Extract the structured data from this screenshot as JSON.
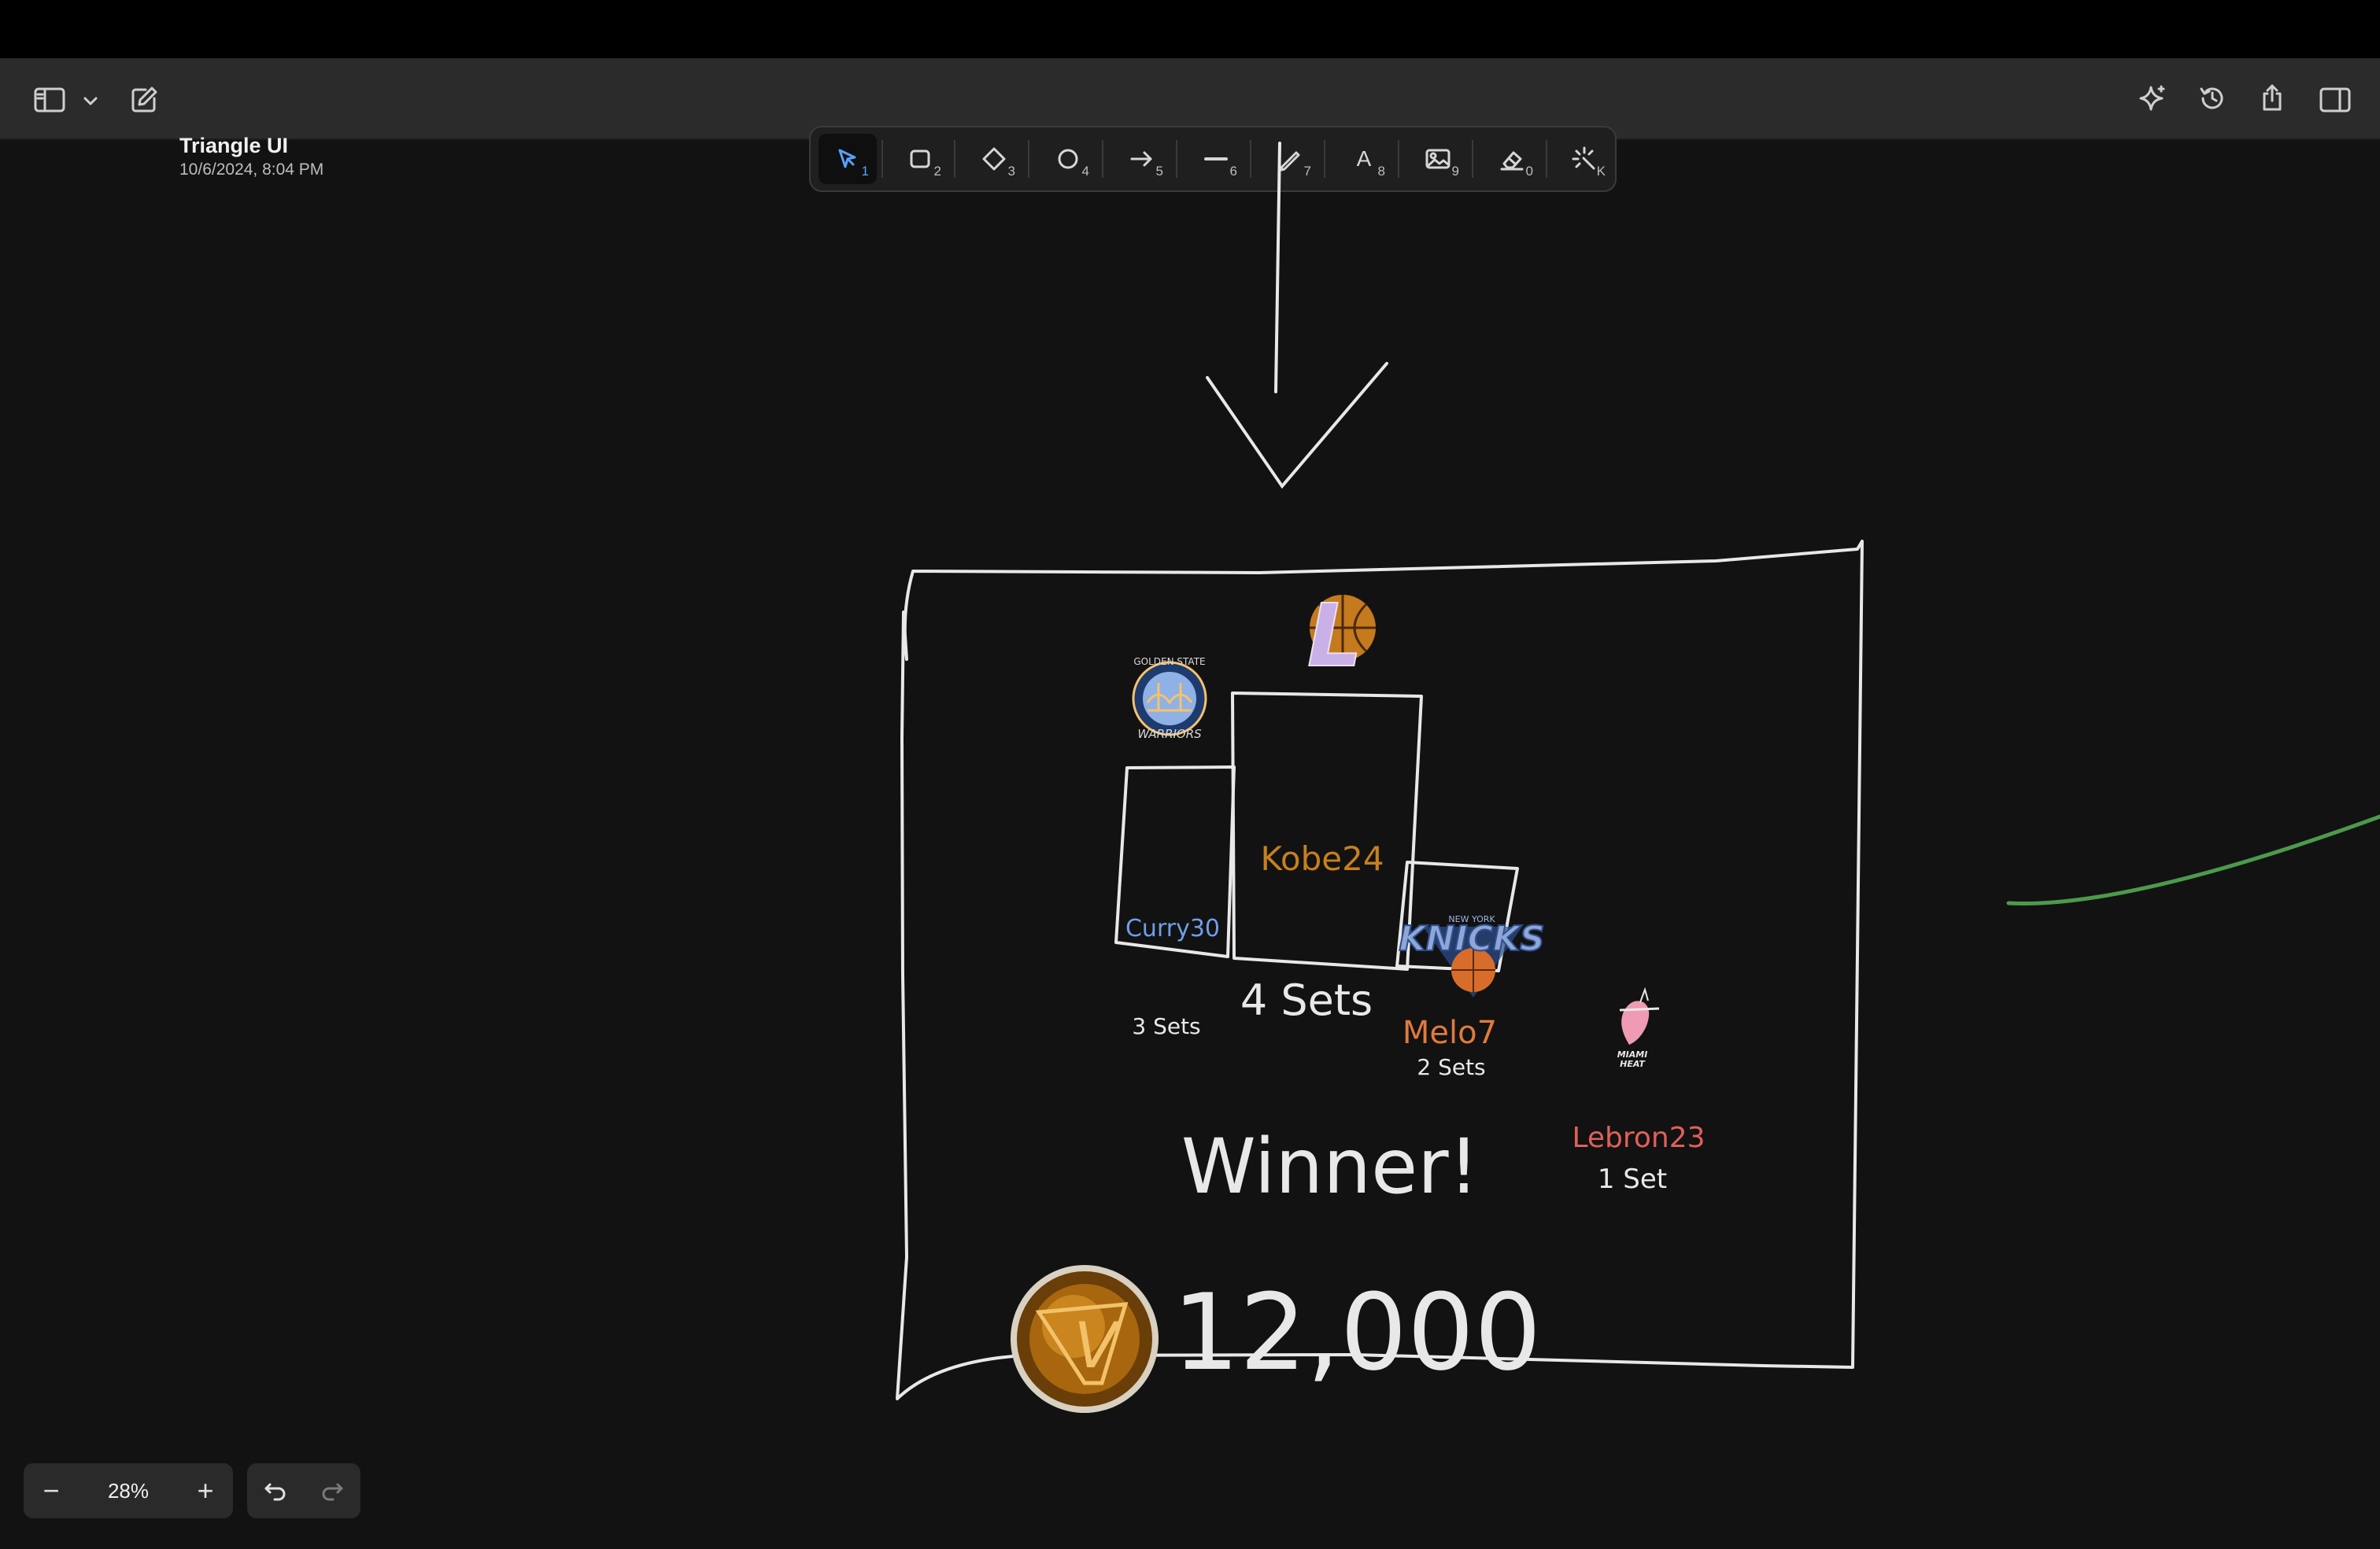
{
  "document": {
    "title": "Triangle UI",
    "date": "10/6/2024, 8:04 PM"
  },
  "toolbar": {
    "tools": [
      {
        "name": "select",
        "shortcut": "1",
        "icon": "cursor-icon",
        "active": true
      },
      {
        "name": "rectangle",
        "shortcut": "2",
        "icon": "rectangle-icon"
      },
      {
        "name": "diamond",
        "shortcut": "3",
        "icon": "diamond-icon"
      },
      {
        "name": "ellipse",
        "shortcut": "4",
        "icon": "circle-icon"
      },
      {
        "name": "arrow",
        "shortcut": "5",
        "icon": "arrow-icon"
      },
      {
        "name": "line",
        "shortcut": "6",
        "icon": "line-icon"
      },
      {
        "name": "draw",
        "shortcut": "7",
        "icon": "pencil-icon"
      },
      {
        "name": "text",
        "shortcut": "8",
        "icon": "text-icon",
        "label": "A"
      },
      {
        "name": "image",
        "shortcut": "9",
        "icon": "image-icon"
      },
      {
        "name": "eraser",
        "shortcut": "0",
        "icon": "eraser-icon"
      },
      {
        "name": "laser",
        "shortcut": "K",
        "icon": "laser-icon"
      }
    ],
    "accent": "#5aa0ff"
  },
  "right_actions": [
    "sparkle-icon",
    "history-icon",
    "share-icon",
    "sidebar-right-icon"
  ],
  "canvas": {
    "podium": {
      "curry": {
        "name": "Curry30",
        "sets": "3 Sets",
        "color": "#6f9ee8"
      },
      "kobe": {
        "name": "Kobe24",
        "sets": "4 Sets",
        "color": "#c7801f"
      },
      "melo": {
        "name": "Melo7",
        "sets": "2 Sets",
        "color": "#e07a3d"
      },
      "lebron": {
        "name": "Lebron23",
        "sets": "1 Set",
        "color": "#e0605a"
      }
    },
    "winner_label": "Winner!",
    "score": "12,000",
    "logos": {
      "warriors": {
        "top": "GOLDEN STATE",
        "bottom": "WARRIORS"
      },
      "knicks": {
        "text": "KNICKS",
        "top": "NEW YORK"
      },
      "heat": {
        "line1": "MIAMI",
        "line2": "HEAT"
      },
      "lakers": {
        "letter": "L"
      },
      "coin": {
        "letter": "V"
      }
    }
  },
  "zoom": {
    "value": "28%",
    "minus": "−",
    "plus": "+"
  }
}
